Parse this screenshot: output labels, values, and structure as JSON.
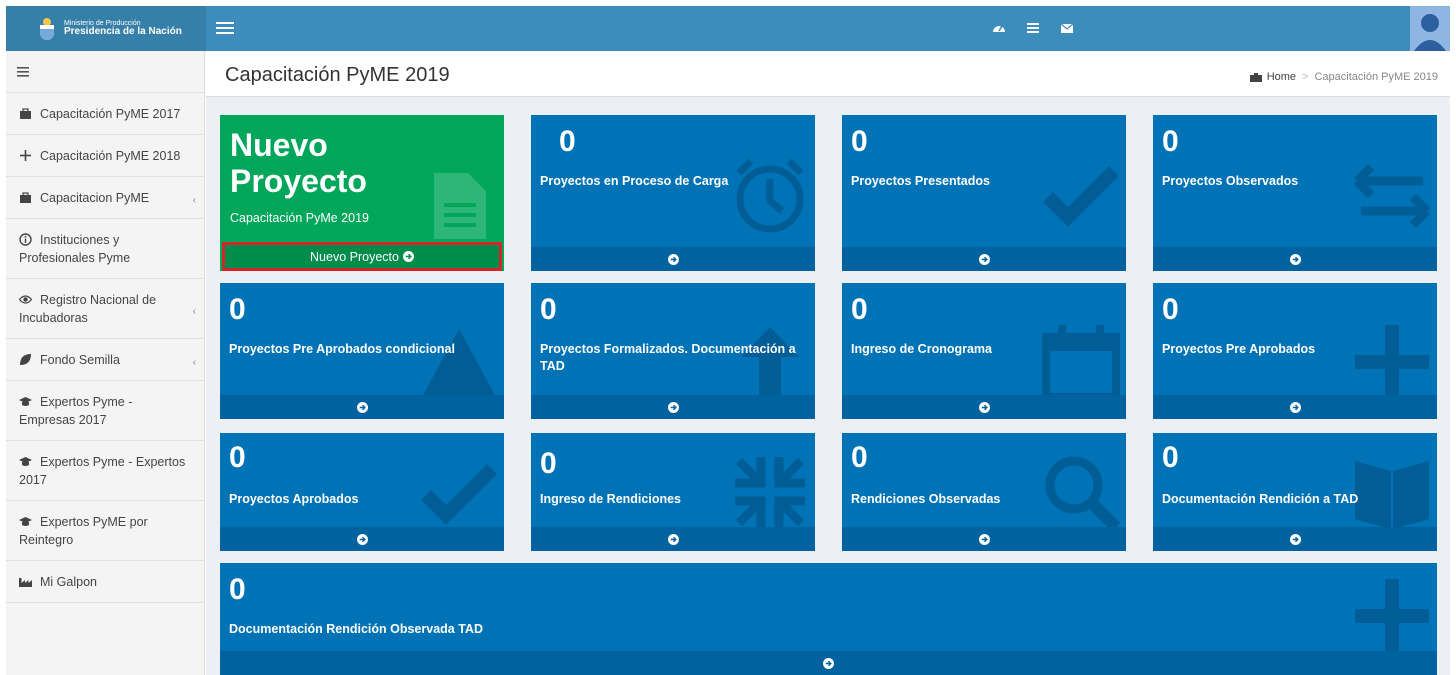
{
  "topbar": {
    "logo_line1": "Ministerio de Producción",
    "logo_line2": "Presidencia de la Nación",
    "icons": [
      "dashboard-icon",
      "list-icon",
      "envelope-icon"
    ],
    "accent": "#3c8dbc"
  },
  "sidebar": {
    "items": [
      {
        "label": "Capacitación PyME 2017",
        "icon": "briefcase-icon",
        "chevron": false
      },
      {
        "label": "Capacitación PyME 2018",
        "icon": "plus-icon",
        "chevron": false
      },
      {
        "label": "Capacitacion PyME",
        "icon": "briefcase-icon",
        "chevron": true
      },
      {
        "label": "Instituciones y Profesionales Pyme",
        "icon": "info-icon",
        "chevron": false
      },
      {
        "label": "Registro Nacional de Incubadoras",
        "icon": "eye-icon",
        "chevron": true
      },
      {
        "label": "Fondo Semilla",
        "icon": "leaf-icon",
        "chevron": true
      },
      {
        "label": "Expertos Pyme - Empresas 2017",
        "icon": "graduation-cap-icon",
        "chevron": false
      },
      {
        "label": "Expertos Pyme - Expertos 2017",
        "icon": "graduation-cap-icon",
        "chevron": false
      },
      {
        "label": "Expertos PyME por Reintegro",
        "icon": "graduation-cap-icon",
        "chevron": false
      },
      {
        "label": "Mi Galpon",
        "icon": "industry-icon",
        "chevron": false
      }
    ]
  },
  "header": {
    "title": "Capacitación PyME 2019",
    "breadcrumb_home": "Home",
    "breadcrumb_current": "Capacitación PyME 2019"
  },
  "new_project": {
    "title_line1": "Nuevo",
    "title_line2": "Proyecto",
    "subtitle": "Capacitación PyMe 2019",
    "button_label": "Nuevo Proyecto",
    "color": "#00a65a"
  },
  "tiles": [
    {
      "count": "0",
      "label": "Proyectos en Proceso de Carga",
      "icon": "clock-icon"
    },
    {
      "count": "0",
      "label": "Proyectos Presentados",
      "icon": "check-icon"
    },
    {
      "count": "0",
      "label": "Proyectos Observados",
      "icon": "exchange-icon"
    },
    {
      "count": "0",
      "label": "Proyectos Pre Aprobados condicional",
      "icon": "warning-icon"
    },
    {
      "count": "0",
      "label": "Proyectos Formalizados. Documentación a TAD",
      "icon": "arrow-up-icon"
    },
    {
      "count": "0",
      "label": "Ingreso de Cronograma",
      "icon": "calendar-icon"
    },
    {
      "count": "0",
      "label": "Proyectos Pre Aprobados",
      "icon": "plus-icon"
    },
    {
      "count": "0",
      "label": "Proyectos Aprobados",
      "icon": "check-icon"
    },
    {
      "count": "0",
      "label": "Ingreso de Rendiciones",
      "icon": "compress-icon"
    },
    {
      "count": "0",
      "label": "Rendiciones Observadas",
      "icon": "search-icon"
    },
    {
      "count": "0",
      "label": "Documentación Rendición a TAD",
      "icon": "book-icon"
    },
    {
      "count": "0",
      "label": "Documentación Rendición Observada TAD",
      "icon": "plus-icon"
    }
  ],
  "tile_color": "#0073b7"
}
